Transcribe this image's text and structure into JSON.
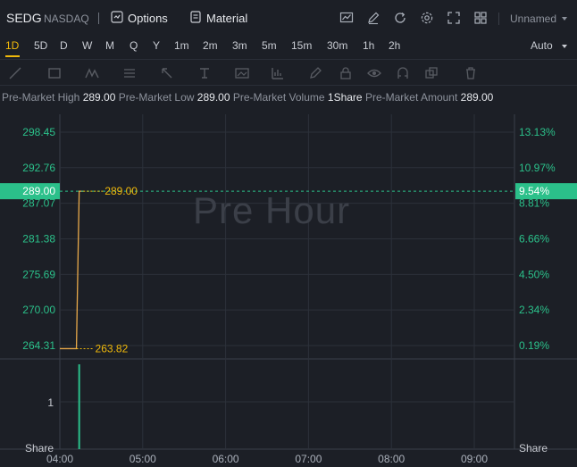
{
  "header": {
    "symbol": "SEDG",
    "exchange": "NASDAQ",
    "options_label": "Options",
    "material_label": "Material",
    "layout_name": "Unnamed"
  },
  "timeframes": [
    "1D",
    "5D",
    "D",
    "W",
    "M",
    "Q",
    "Y",
    "1m",
    "2m",
    "3m",
    "5m",
    "15m",
    "30m",
    "1h",
    "2h"
  ],
  "active_timeframe": "1D",
  "scale_mode": "Auto",
  "info": {
    "high_label": "Pre-Market High",
    "high_value": "289.00",
    "low_label": "Pre-Market Low",
    "low_value": "289.00",
    "volume_label": "Pre-Market Volume",
    "volume_value": "1Share",
    "amount_label": "Pre-Market Amount",
    "amount_value": "289.00"
  },
  "watermark": "Pre Hour",
  "colors": {
    "accent": "#f0b90b",
    "up": "#2bc08a",
    "price_line": "#e8a94a",
    "background": "#1c1f26",
    "grid": "#2c313a"
  },
  "chart_data": {
    "type": "line",
    "price_axis_labels": [
      "298.45",
      "292.76",
      "287.07",
      "281.38",
      "275.69",
      "270.00",
      "264.31"
    ],
    "percent_axis_labels": [
      "13.13%",
      "10.97%",
      "8.81%",
      "6.66%",
      "4.50%",
      "2.34%",
      "0.19%"
    ],
    "last_price": "289.00",
    "last_percent": "9.54%",
    "high_marker": "289.00",
    "low_marker": "263.82",
    "x_labels": [
      "04:00",
      "05:00",
      "06:00",
      "07:00",
      "08:00",
      "09:00"
    ],
    "price_range": [
      263.6,
      301.3
    ],
    "series": [
      {
        "time": "04:00",
        "price": 263.82
      },
      {
        "time": "04:12",
        "price": 263.82
      },
      {
        "time": "04:14",
        "price": 289.0
      },
      {
        "time": "04:17",
        "price": 289.0
      }
    ],
    "volume_axis_label": "1",
    "volume_unit": "Share",
    "volume": [
      {
        "time": "04:14",
        "value": 1
      }
    ]
  }
}
